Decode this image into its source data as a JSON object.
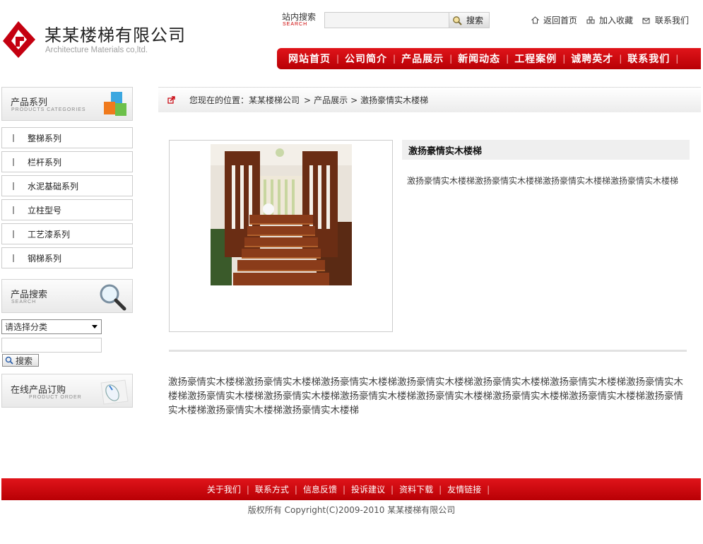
{
  "header": {
    "company_name": "某某楼梯有限公司",
    "company_sub": "Architecture Materials co,ltd.",
    "search_label": "站内搜索",
    "search_label_en": "SEARCH",
    "search_button": "搜索",
    "top_links": [
      "返回首页",
      "加入收藏",
      "联系我们"
    ]
  },
  "nav": {
    "items": [
      "网站首页",
      "公司简介",
      "产品展示",
      "新闻动态",
      "工程案例",
      "诚聘英才",
      "联系我们"
    ]
  },
  "sidebar": {
    "categories_title": "产品系列",
    "categories_title_en": "PRODUCTS CATEGORIES",
    "categories": [
      "整梯系列",
      "栏杆系列",
      "水泥基础系列",
      "立柱型号",
      "工艺漆系列",
      "钢梯系列"
    ],
    "search_title": "产品搜索",
    "search_title_en": "SEARCH",
    "select_value": "请选择分类",
    "search_button": "搜索",
    "order_title": "在线产品订购",
    "order_title_en": "PRODUCT ORDER"
  },
  "breadcrumb": {
    "prefix": "您现在的位置：",
    "items": [
      "某某楼梯公司",
      "产品展示",
      "激扬豪情实木楼梯"
    ],
    "separator": ">"
  },
  "product": {
    "title": "激扬豪情实木楼梯",
    "short_desc": "激扬豪情实木楼梯激扬豪情实木楼梯激扬豪情实木楼梯激扬豪情实木楼梯",
    "long_desc": "激扬豪情实木楼梯激扬豪情实木楼梯激扬豪情实木楼梯激扬豪情实木楼梯激扬豪情实木楼梯激扬豪情实木楼梯激扬豪情实木楼梯激扬豪情实木楼梯激扬豪情实木楼梯激扬豪情实木楼梯激扬豪情实木楼梯激扬豪情实木楼梯激扬豪情实木楼梯激扬豪情实木楼梯激扬豪情实木楼梯激扬豪情实木楼梯"
  },
  "footer": {
    "links": [
      "关于我们",
      "联系方式",
      "信息反馈",
      "投诉建议",
      "资料下载",
      "友情链接"
    ],
    "copyright": "版权所有  Copyright(C)2009-2010 某某楼梯有限公司"
  },
  "colors": {
    "brand_red": "#c8000a"
  }
}
